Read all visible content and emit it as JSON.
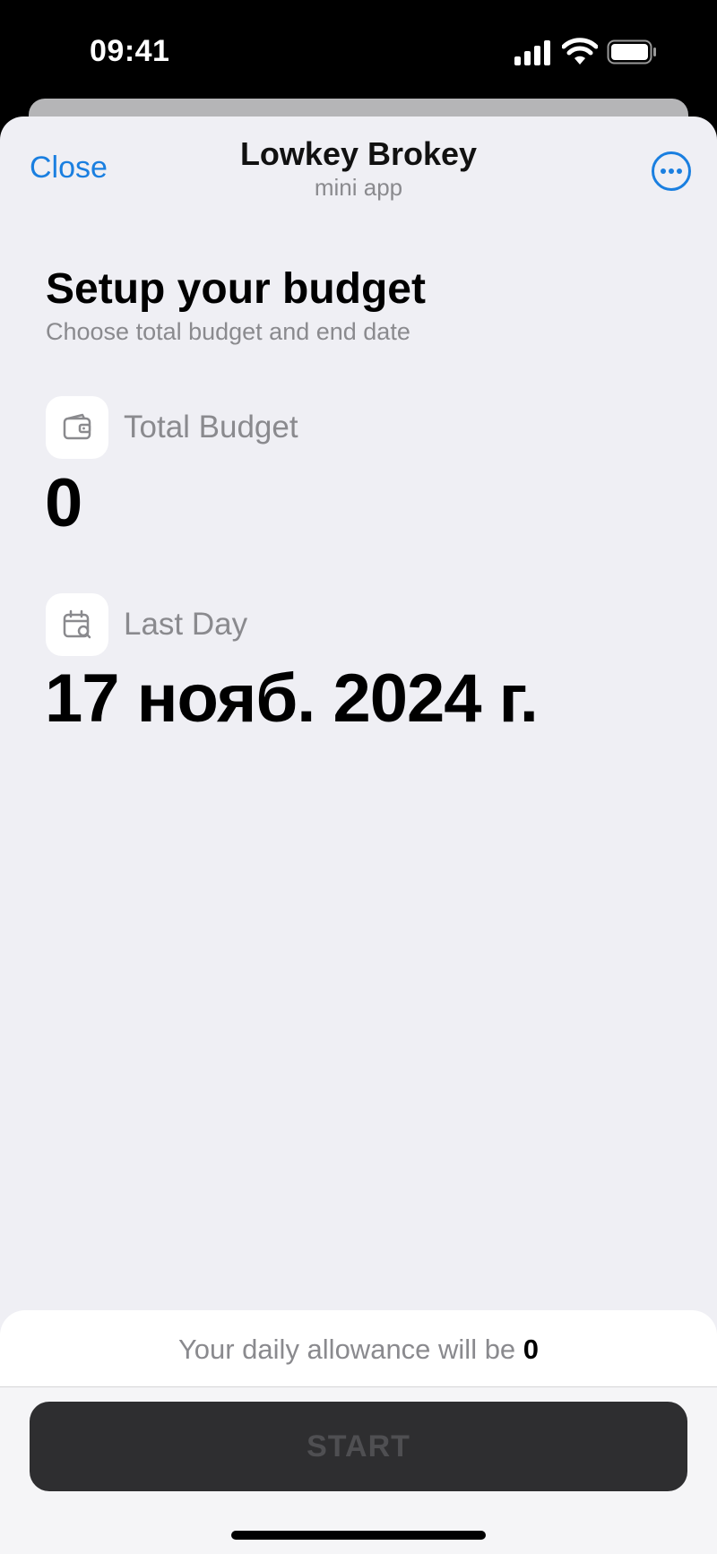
{
  "status": {
    "time": "09:41"
  },
  "header": {
    "close_label": "Close",
    "title": "Lowkey Brokey",
    "subtitle": "mini app"
  },
  "setup": {
    "heading": "Setup your budget",
    "subheading": "Choose total budget and end date"
  },
  "total_budget": {
    "label": "Total Budget",
    "value": "0",
    "icon": "wallet-icon"
  },
  "last_day": {
    "label": "Last Day",
    "value": "17 нояб. 2024 г.",
    "icon": "calendar-search-icon"
  },
  "footer": {
    "allowance_text": "Your daily allowance will be",
    "allowance_value": "0",
    "start_label": "START"
  },
  "colors": {
    "accent": "#1a7fe0",
    "background": "#efeff4",
    "button": "#2e2e30",
    "secondary_text": "#8a8a8e"
  }
}
